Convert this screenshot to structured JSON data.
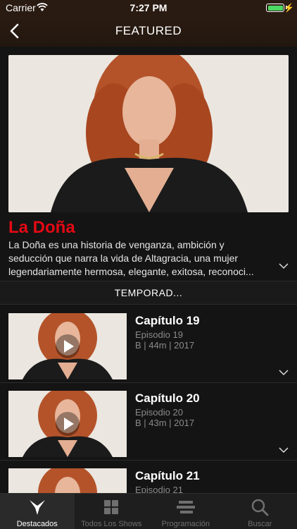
{
  "status_bar": {
    "carrier": "Carrier",
    "time": "7:27 PM"
  },
  "nav": {
    "title": "FEATURED"
  },
  "show": {
    "title": "La Doña",
    "description": "La Doña es una historia de venganza, ambición y seducción que narra la vida de Altagracia, una mujer legendariamente hermosa, elegante, exitosa, reconoci..."
  },
  "season_selector": {
    "label": "TEMPORAD..."
  },
  "episodes": [
    {
      "title": "Capítulo 19",
      "episode": "Episodio 19",
      "meta": "B | 44m | 2017"
    },
    {
      "title": "Capítulo 20",
      "episode": "Episodio 20",
      "meta": "B | 43m | 2017"
    },
    {
      "title": "Capítulo 21",
      "episode": "Episodio 21",
      "meta": ""
    }
  ],
  "tabs": [
    {
      "label": "Destacados",
      "icon": "destacados-icon",
      "active": true
    },
    {
      "label": "Todos Los Shows",
      "icon": "grid-icon",
      "active": false
    },
    {
      "label": "Programación",
      "icon": "schedule-icon",
      "active": false
    },
    {
      "label": "Buscar",
      "icon": "search-icon",
      "active": false
    }
  ],
  "colors": {
    "accent": "#e50914",
    "background": "#141414",
    "nav_bg": "#2a1b12",
    "battery": "#4cd964"
  }
}
